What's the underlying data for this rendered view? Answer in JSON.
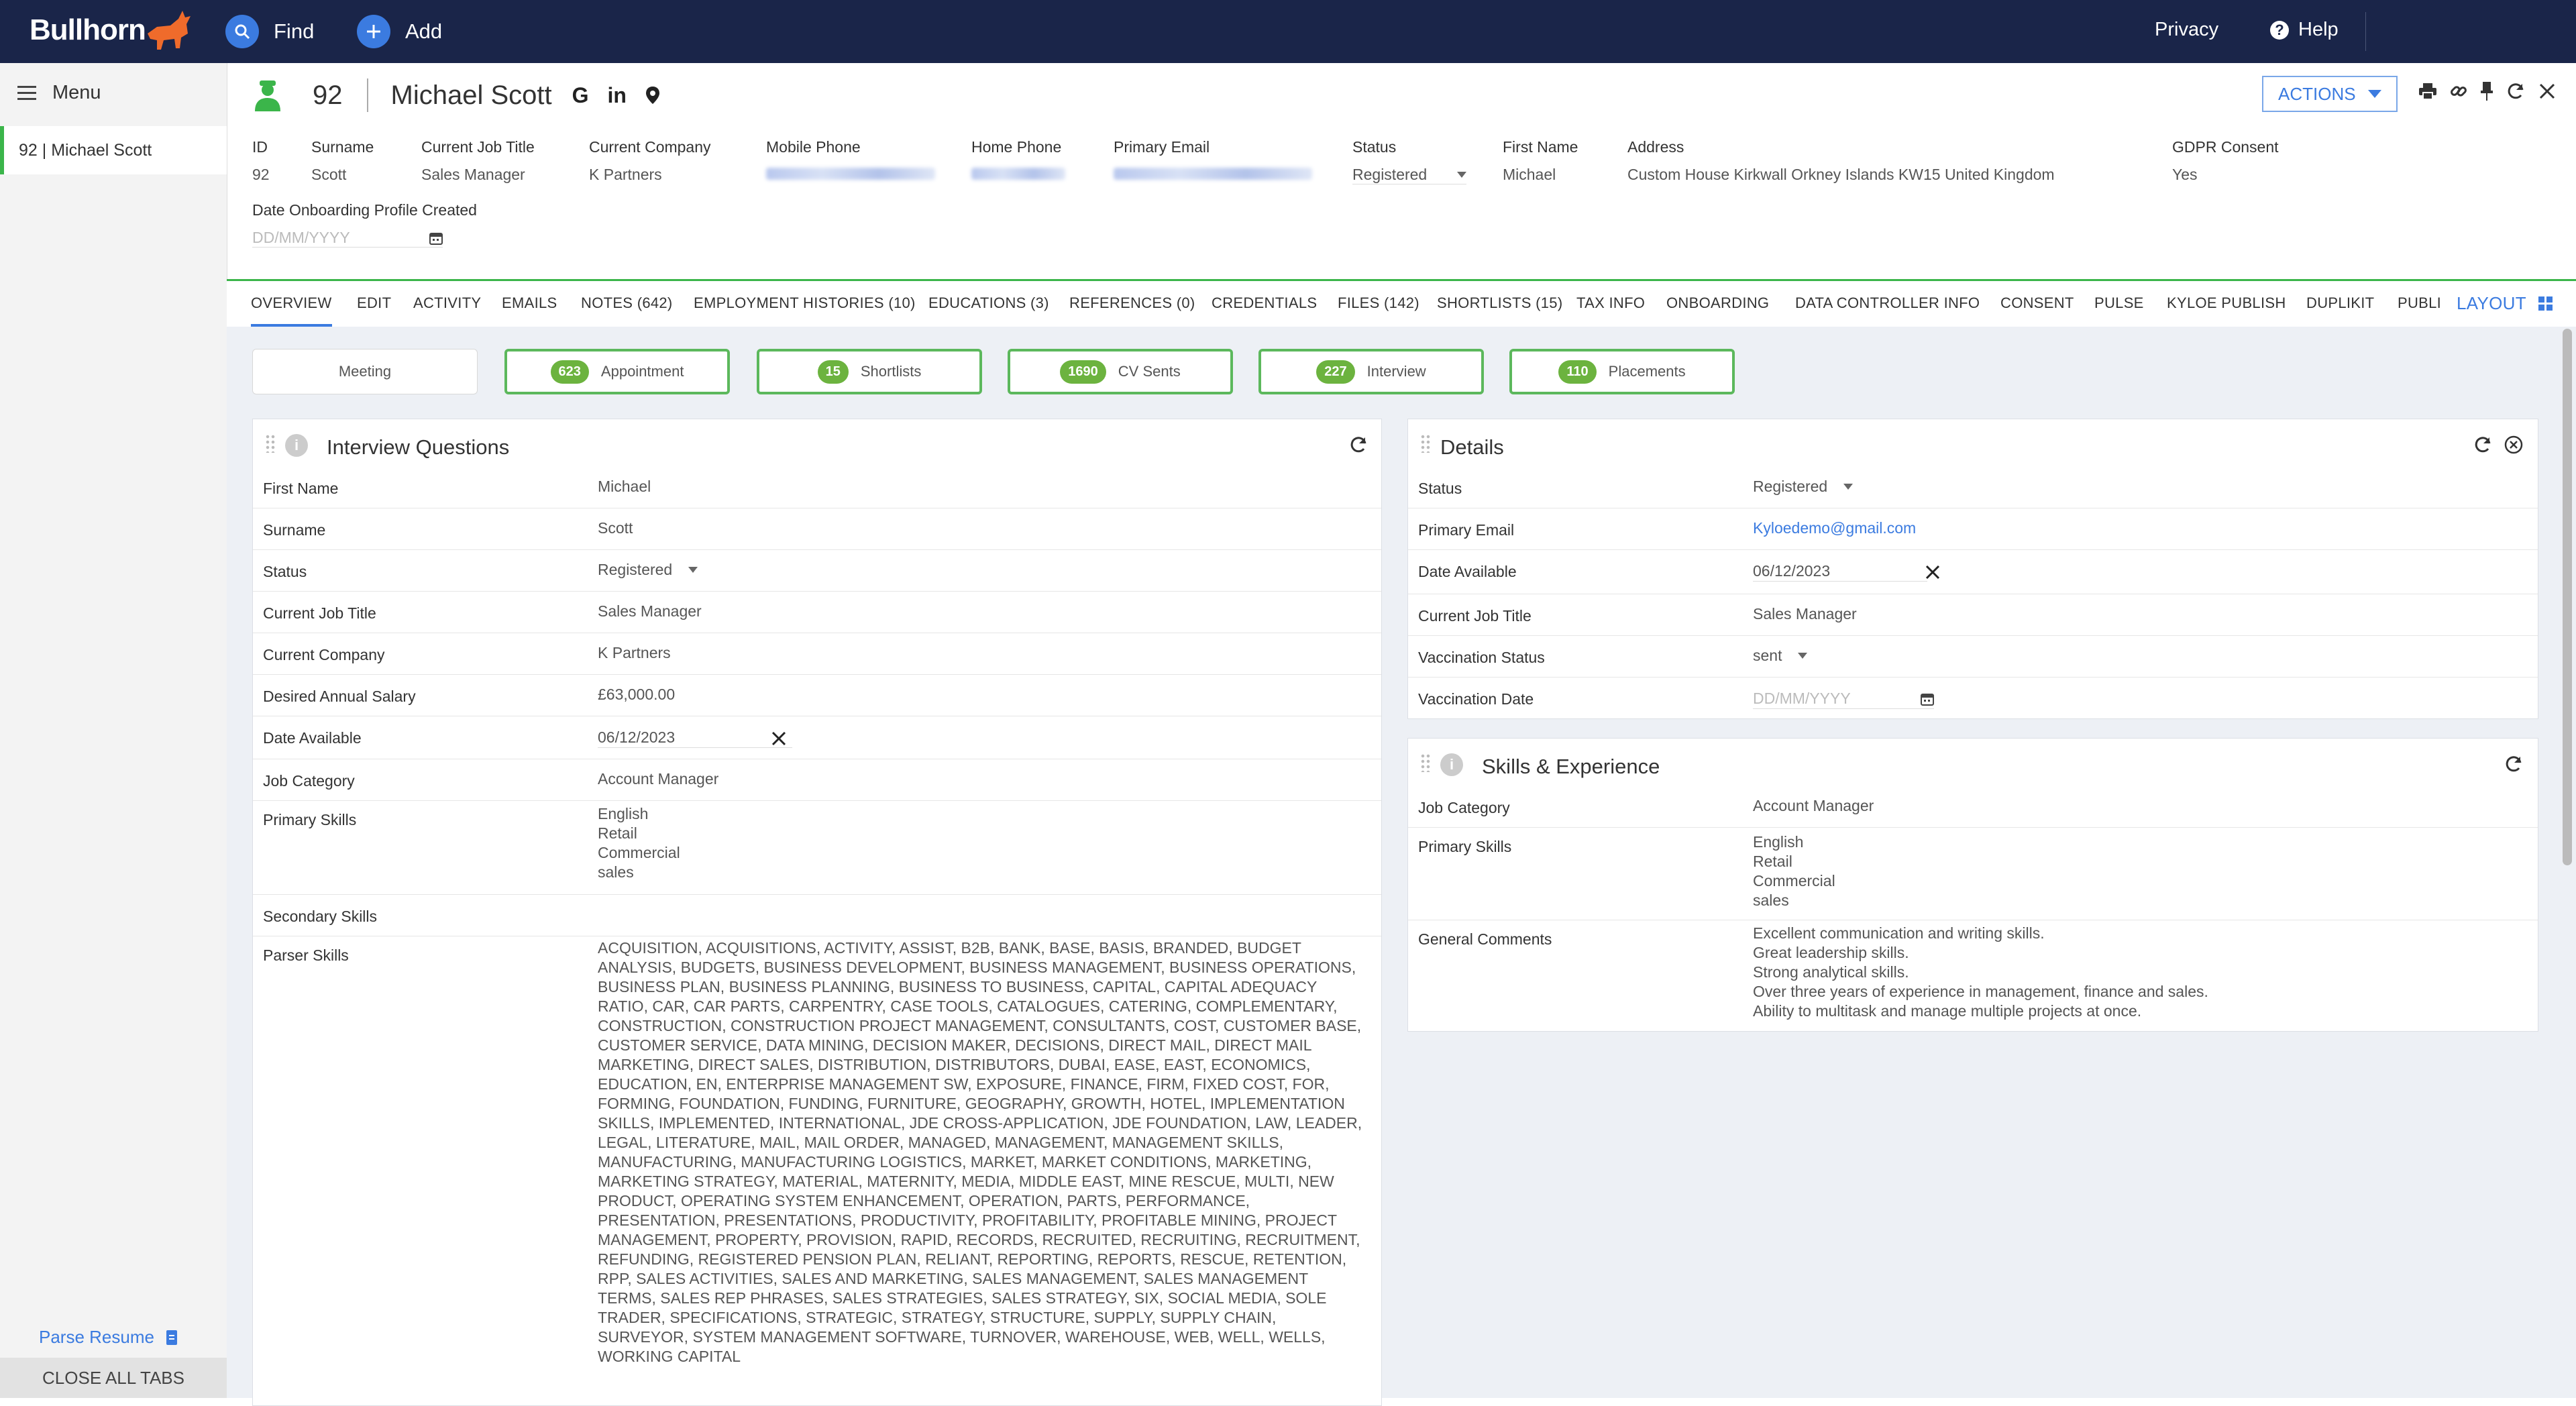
{
  "topbar": {
    "logo": "Bullhorn",
    "find": "Find",
    "add": "Add",
    "privacy": "Privacy",
    "help": "Help"
  },
  "sidebar": {
    "menu": "Menu",
    "open_tab": "92 | Michael Scott",
    "parse_resume": "Parse Resume",
    "close_all": "CLOSE ALL TABS"
  },
  "header": {
    "id": "92",
    "name": "Michael Scott",
    "actions": "ACTIONS"
  },
  "fields": {
    "id": {
      "label": "ID",
      "value": "92"
    },
    "surname": {
      "label": "Surname",
      "value": "Scott"
    },
    "job_title": {
      "label": "Current Job Title",
      "value": "Sales Manager"
    },
    "company": {
      "label": "Current Company",
      "value": "K Partners"
    },
    "mobile": {
      "label": "Mobile Phone"
    },
    "home": {
      "label": "Home Phone"
    },
    "email": {
      "label": "Primary Email"
    },
    "status": {
      "label": "Status",
      "value": "Registered"
    },
    "first_name": {
      "label": "First Name",
      "value": "Michael"
    },
    "address": {
      "label": "Address",
      "value": "Custom House Kirkwall Orkney Islands KW15 United Kingdom"
    },
    "gdpr": {
      "label": "GDPR Consent",
      "value": "Yes"
    },
    "onboarding": {
      "label": "Date Onboarding Profile Created",
      "placeholder": "DD/MM/YYYY"
    }
  },
  "tabs": [
    "OVERVIEW",
    "EDIT",
    "ACTIVITY",
    "EMAILS",
    "NOTES (642)",
    "EMPLOYMENT HISTORIES (10)",
    "EDUCATIONS (3)",
    "REFERENCES (0)",
    "CREDENTIALS",
    "FILES (142)",
    "SHORTLISTS (15)",
    "TAX INFO",
    "ONBOARDING",
    "DATA CONTROLLER INFO",
    "CONSENT",
    "PULSE",
    "KYLOE PUBLISH",
    "DUPLIKIT",
    "PUBLI"
  ],
  "layout_label": "LAYOUT",
  "counters": [
    {
      "label": "Meeting"
    },
    {
      "count": "623",
      "label": "Appointment"
    },
    {
      "count": "15",
      "label": "Shortlists"
    },
    {
      "count": "1690",
      "label": "CV Sents"
    },
    {
      "count": "227",
      "label": "Interview"
    },
    {
      "count": "110",
      "label": "Placements"
    }
  ],
  "interview": {
    "title": "Interview Questions",
    "rows": [
      {
        "k": "First Name",
        "v": "Michael"
      },
      {
        "k": "Surname",
        "v": "Scott"
      },
      {
        "k": "Status",
        "v": "Registered"
      },
      {
        "k": "Current Job Title",
        "v": "Sales Manager"
      },
      {
        "k": "Current Company",
        "v": "K Partners"
      },
      {
        "k": "Desired Annual Salary",
        "v": "£63,000.00"
      },
      {
        "k": "Date Available",
        "v": "06/12/2023"
      },
      {
        "k": "Job Category",
        "v": "Account Manager"
      },
      {
        "k": "Primary Skills",
        "v": "English\nRetail\nCommercial\nsales"
      },
      {
        "k": "Secondary Skills",
        "v": ""
      },
      {
        "k": "Parser Skills",
        "v": "ACQUISITION, ACQUISITIONS, ACTIVITY, ASSIST, B2B, BANK, BASE, BASIS, BRANDED, BUDGET ANALYSIS, BUDGETS, BUSINESS DEVELOPMENT, BUSINESS MANAGEMENT, BUSINESS OPERATIONS, BUSINESS PLAN, BUSINESS PLANNING, BUSINESS TO BUSINESS, CAPITAL, CAPITAL ADEQUACY RATIO, CAR, CAR PARTS, CARPENTRY, CASE TOOLS, CATALOGUES, CATERING, COMPLEMENTARY, CONSTRUCTION, CONSTRUCTION PROJECT MANAGEMENT, CONSULTANTS, COST, CUSTOMER BASE, CUSTOMER SERVICE, DATA MINING, DECISION MAKER, DECISIONS, DIRECT MAIL, DIRECT MAIL MARKETING, DIRECT SALES, DISTRIBUTION, DISTRIBUTORS, DUBAI, EASE, EAST, ECONOMICS, EDUCATION, EN, ENTERPRISE MANAGEMENT SW, EXPOSURE, FINANCE, FIRM, FIXED COST, FOR, FORMING, FOUNDATION, FUNDING, FURNITURE, GEOGRAPHY, GROWTH, HOTEL, IMPLEMENTATION SKILLS, IMPLEMENTED, INTERNATIONAL, JDE CROSS-APPLICATION, JDE FOUNDATION, LAW, LEADER, LEGAL, LITERATURE, MAIL, MAIL ORDER, MANAGED, MANAGEMENT, MANAGEMENT SKILLS, MANUFACTURING, MANUFACTURING LOGISTICS, MARKET, MARKET CONDITIONS, MARKETING, MARKETING STRATEGY, MATERIAL, MATERNITY, MEDIA, MIDDLE EAST, MINE RESCUE, MULTI, NEW PRODUCT, OPERATING SYSTEM ENHANCEMENT, OPERATION, PARTS, PERFORMANCE, PRESENTATION, PRESENTATIONS, PRODUCTIVITY, PROFITABILITY, PROFITABLE MINING, PROJECT MANAGEMENT, PROPERTY, PROVISION, RAPID, RECORDS, RECRUITED, RECRUITING, RECRUITMENT, REFUNDING, REGISTERED PENSION PLAN, RELIANT, REPORTING, REPORTS, RESCUE, RETENTION, RPP, SALES ACTIVITIES, SALES AND MARKETING, SALES MANAGEMENT, SALES MANAGEMENT TERMS, SALES REP PHRASES, SALES STRATEGIES, SALES STRATEGY, SIX, SOCIAL MEDIA, SOLE TRADER, SPECIFICATIONS, STRATEGIC, STRATEGY, STRUCTURE, SUPPLY, SUPPLY CHAIN, SURVEYOR, SYSTEM MANAGEMENT SOFTWARE, TURNOVER, WAREHOUSE, WEB, WELL, WELLS, WORKING CAPITAL"
      }
    ]
  },
  "details": {
    "title": "Details",
    "rows": [
      {
        "k": "Status",
        "v": "Registered"
      },
      {
        "k": "Primary Email",
        "v": "Kyloedemo@gmail.com"
      },
      {
        "k": "Date Available",
        "v": "06/12/2023"
      },
      {
        "k": "Current Job Title",
        "v": "Sales Manager"
      },
      {
        "k": "Vaccination Status",
        "v": "sent"
      },
      {
        "k": "Vaccination Date",
        "v": "DD/MM/YYYY"
      }
    ]
  },
  "skills": {
    "title": "Skills & Experience",
    "rows": [
      {
        "k": "Job Category",
        "v": "Account Manager"
      },
      {
        "k": "Primary Skills",
        "v": "English\nRetail\nCommercial\nsales"
      },
      {
        "k": "General Comments",
        "v": "Excellent communication and writing skills.\nGreat leadership skills.\nStrong analytical skills.\nOver three years of experience in management, finance and sales.\nAbility to multitask and manage multiple projects at once."
      }
    ]
  }
}
